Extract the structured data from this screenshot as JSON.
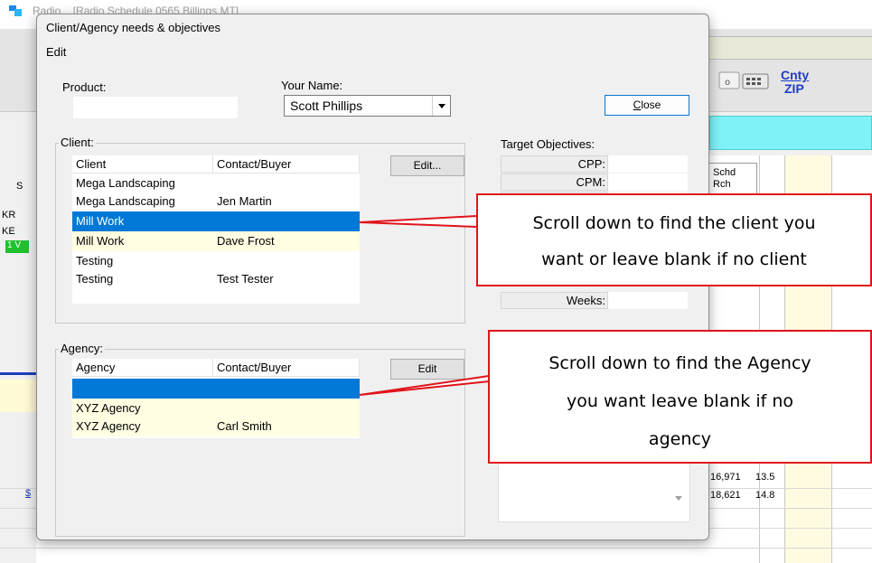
{
  "background_app": {
    "title": "Radio... [Radio Schedule 0565 Billings MT]",
    "schd_label": "Schd",
    "rch_label": "Rch",
    "cnty_label": "Cnty",
    "zip_label": "ZIP",
    "row_labels": [
      "KR",
      "KE",
      "1 V",
      "S",
      "$"
    ],
    "grid_values": [
      {
        "value": "16,971",
        "pct": "13.5"
      },
      {
        "value": "18,621",
        "pct": "14.8"
      }
    ]
  },
  "dialog": {
    "title": "Client/Agency needs & objectives",
    "menu": [
      "Edit"
    ],
    "product_label": "Product:",
    "product_value": "",
    "your_name_label": "Your Name:",
    "your_name_value": "Scott Phillips",
    "close_label": "Close",
    "close_mnemonic": "C",
    "client_group": {
      "title": "Client:",
      "edit_label": "Edit...",
      "columns": [
        "Client",
        "Contact/Buyer"
      ],
      "rows": [
        {
          "client": "Mega Landscaping",
          "contact": ""
        },
        {
          "client": "Mega Landscaping",
          "contact": "Jen Martin"
        },
        {
          "client": "Mill Work",
          "contact": "",
          "selected": true
        },
        {
          "client": "Mill Work",
          "contact": "Dave Frost"
        },
        {
          "client": "Testing",
          "contact": ""
        },
        {
          "client": "Testing",
          "contact": "Test Tester"
        }
      ]
    },
    "agency_group": {
      "title": "Agency:",
      "edit_label": "Edit",
      "columns": [
        "Agency",
        "Contact/Buyer"
      ],
      "rows": [
        {
          "agency": "",
          "contact": "",
          "selected": true
        },
        {
          "agency": "XYZ Agency",
          "contact": ""
        },
        {
          "agency": "XYZ Agency",
          "contact": "Carl Smith"
        }
      ]
    },
    "target_objectives": {
      "title": "Target Objectives:",
      "items": [
        {
          "label": "CPP:",
          "value": ""
        },
        {
          "label": "CPM:",
          "value": ""
        },
        {
          "label": "Weeks:",
          "value": ""
        }
      ]
    }
  },
  "callouts": [
    {
      "lines": [
        "Scroll down to find the client you",
        "want or leave blank if no client"
      ]
    },
    {
      "lines": [
        "Scroll down to find the Agency",
        "you want leave blank if no",
        "agency"
      ]
    }
  ],
  "colors": {
    "selection": "#0078d7",
    "alt_row": "#fffde2",
    "callout_border": "#e0141b",
    "cyan_bar": "#7ff2f8"
  }
}
